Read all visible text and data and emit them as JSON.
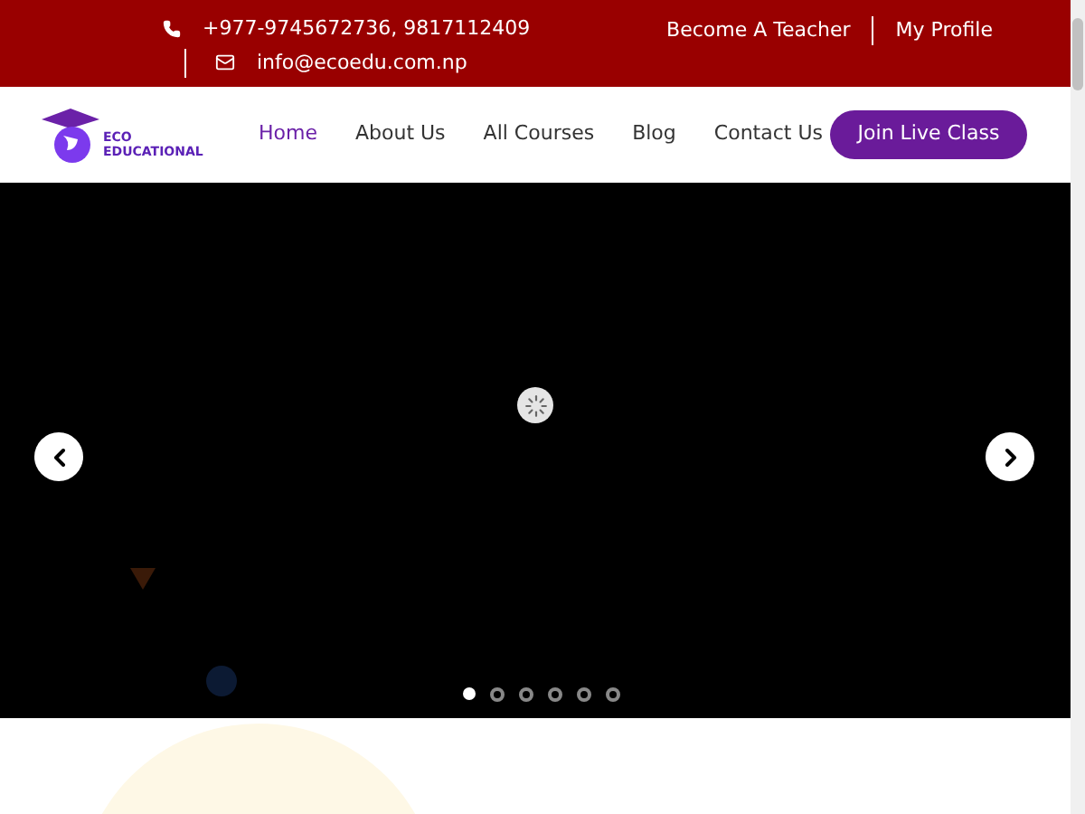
{
  "top_bar": {
    "phone": "+977-9745672736, 9817112409",
    "email": "info@ecoedu.com.np",
    "links": [
      "Become A Teacher",
      "My Profile"
    ]
  },
  "header": {
    "logo": {
      "line_1": "ECO",
      "line_2": "EDUCATIONAL"
    },
    "nav": [
      {
        "label": "Home",
        "selected": true
      },
      {
        "label": "About Us",
        "selected": false
      },
      {
        "label": "All Courses",
        "selected": false
      },
      {
        "label": "Blog",
        "selected": false
      },
      {
        "label": "Contact Us",
        "selected": false
      }
    ],
    "cta": "Join Live Class"
  },
  "slider": {
    "dots": [
      {
        "selected": true
      },
      {
        "selected": false
      },
      {
        "selected": false
      },
      {
        "selected": false
      },
      {
        "selected": false
      },
      {
        "selected": false
      }
    ]
  }
}
